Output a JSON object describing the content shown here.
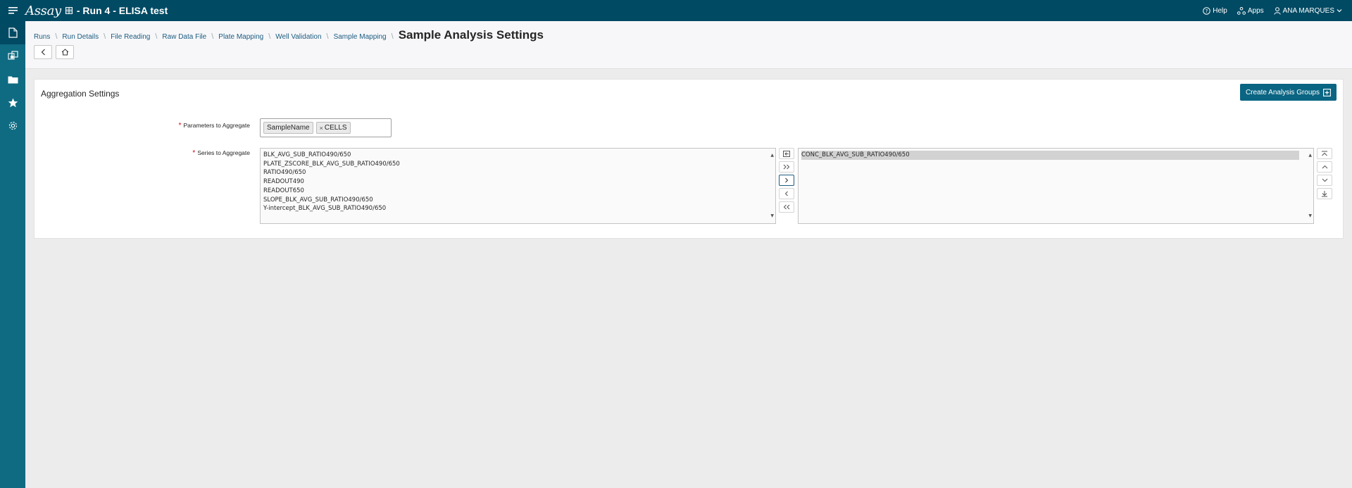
{
  "topbar": {
    "logo": "Assay",
    "title": "- Run 4 - ELISA test",
    "help": "Help",
    "apps": "Apps",
    "user": "ANA MARQUES"
  },
  "breadcrumb": {
    "items": [
      "Runs",
      "Run Details",
      "File Reading",
      "Raw Data File",
      "Plate Mapping",
      "Well Validation",
      "Sample Mapping"
    ],
    "current": "Sample Analysis Settings"
  },
  "card": {
    "title": "Aggregation Settings",
    "create_button": "Create Analysis Groups"
  },
  "params": {
    "label": "Parameters to Aggregate",
    "chips": [
      "SampleName",
      "CELLS"
    ]
  },
  "series": {
    "label": "Series to Aggregate",
    "available": [
      "BLK_AVG_SUB_RATIO490/650",
      "PLATE_ZSCORE_BLK_AVG_SUB_RATIO490/650",
      "RATIO490/650",
      "READOUT490",
      "READOUT650",
      "SLOPE_BLK_AVG_SUB_RATIO490/650",
      "Y-intercept_BLK_AVG_SUB_RATIO490/650"
    ],
    "selected": [
      "CONC_BLK_AVG_SUB_RATIO490/650"
    ]
  },
  "colors": {
    "topbar": "#014a63",
    "sidenav": "#0f6b82",
    "primary_button": "#0a6583",
    "required": "#d6000b"
  }
}
